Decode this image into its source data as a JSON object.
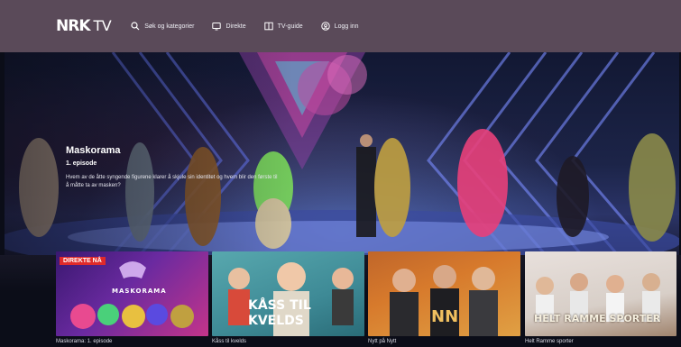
{
  "header": {
    "logo": "NRK",
    "logo_suffix": "TV",
    "nav": [
      {
        "label": "Søk og kategorier",
        "icon": "search-icon"
      },
      {
        "label": "Direkte",
        "icon": "tv-screen-icon"
      },
      {
        "label": "TV-guide",
        "icon": "book-icon"
      },
      {
        "label": "Logg inn",
        "icon": "user-circle-icon"
      }
    ]
  },
  "hero": {
    "title": "Maskorama",
    "episode": "1. episode",
    "description": "Hvem av de åtte syngende figurene klarer å skjule sin identitet og hvem blir den første til å måtte ta av masken?"
  },
  "rail": [
    {
      "caption": "Maskorama: 1. episode",
      "badge": "DIREKTE NÅ",
      "art_text": "MASKORAMA"
    },
    {
      "caption": "Kåss til kvelds",
      "art_text_1": "KÅSS TIL",
      "art_text_2": "KVELDS"
    },
    {
      "caption": "Nytt på Nytt",
      "art_text": "NN"
    },
    {
      "caption": "Helt Ramme sporter",
      "art_text": "HELT RAMME SPORTER"
    }
  ],
  "colors": {
    "header_bg": "#5a4a59",
    "page_bg": "#0b0d18",
    "badge_red": "#e02a2a"
  }
}
